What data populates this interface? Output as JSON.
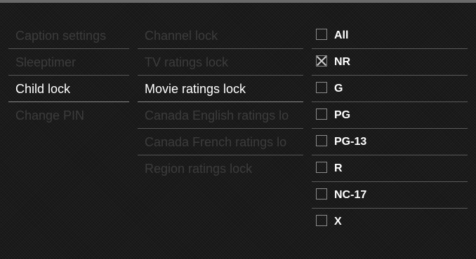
{
  "menu": {
    "items": [
      {
        "label": "Caption settings",
        "active": false
      },
      {
        "label": "Sleeptimer",
        "active": false
      },
      {
        "label": "Child lock",
        "active": true
      },
      {
        "label": "Change PIN",
        "active": false
      }
    ]
  },
  "submenu": {
    "items": [
      {
        "label": "Channel lock",
        "active": false
      },
      {
        "label": "TV ratings lock",
        "active": false
      },
      {
        "label": "Movie ratings lock",
        "active": true
      },
      {
        "label": "Canada English ratings lo",
        "active": false
      },
      {
        "label": "Canada French ratings lo",
        "active": false
      },
      {
        "label": "Region ratings lock",
        "active": false
      }
    ]
  },
  "ratings": {
    "items": [
      {
        "label": "All",
        "checked": false
      },
      {
        "label": "NR",
        "checked": true
      },
      {
        "label": "G",
        "checked": false
      },
      {
        "label": "PG",
        "checked": false
      },
      {
        "label": "PG-13",
        "checked": false
      },
      {
        "label": "R",
        "checked": false
      },
      {
        "label": "NC-17",
        "checked": false
      },
      {
        "label": "X",
        "checked": false
      }
    ]
  }
}
